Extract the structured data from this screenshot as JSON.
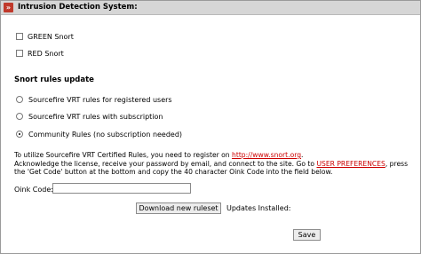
{
  "panel": {
    "title": "Intrusion Detection System:",
    "icon": "double-chevron-right-icon"
  },
  "snort_options": [
    {
      "label": "GREEN Snort",
      "checked": false
    },
    {
      "label": "RED Snort",
      "checked": false
    }
  ],
  "rules_update": {
    "heading": "Snort rules update",
    "options": [
      {
        "label": "Sourcefire VRT rules for registered users",
        "checked": false
      },
      {
        "label": "Sourcefire VRT rules with subscription",
        "checked": false
      },
      {
        "label": "Community Rules (no subscription needed)",
        "checked": true
      }
    ]
  },
  "info": {
    "line1_prefix": "To utilize Sourcefire VRT Certified Rules, you need to register on ",
    "snort_link": "http://www.snort.org",
    "line1_suffix": ".",
    "line2_prefix": "Acknowledge the license, receive your password by email, and connect to the site. Go to ",
    "prefs_link": "USER PREFERENCES",
    "line2_suffix": ", press",
    "line3": "the 'Get Code' button at the bottom and copy the 40 character Oink Code into the field below."
  },
  "oink": {
    "label": "Oink Code:",
    "value": ""
  },
  "buttons": {
    "download": "Download new ruleset",
    "save": "Save"
  },
  "updates_installed": "Updates Installed:",
  "colors": {
    "link": "#cc0000",
    "title_bar": "#d6d6d6",
    "icon_bg": "#c0392b"
  }
}
